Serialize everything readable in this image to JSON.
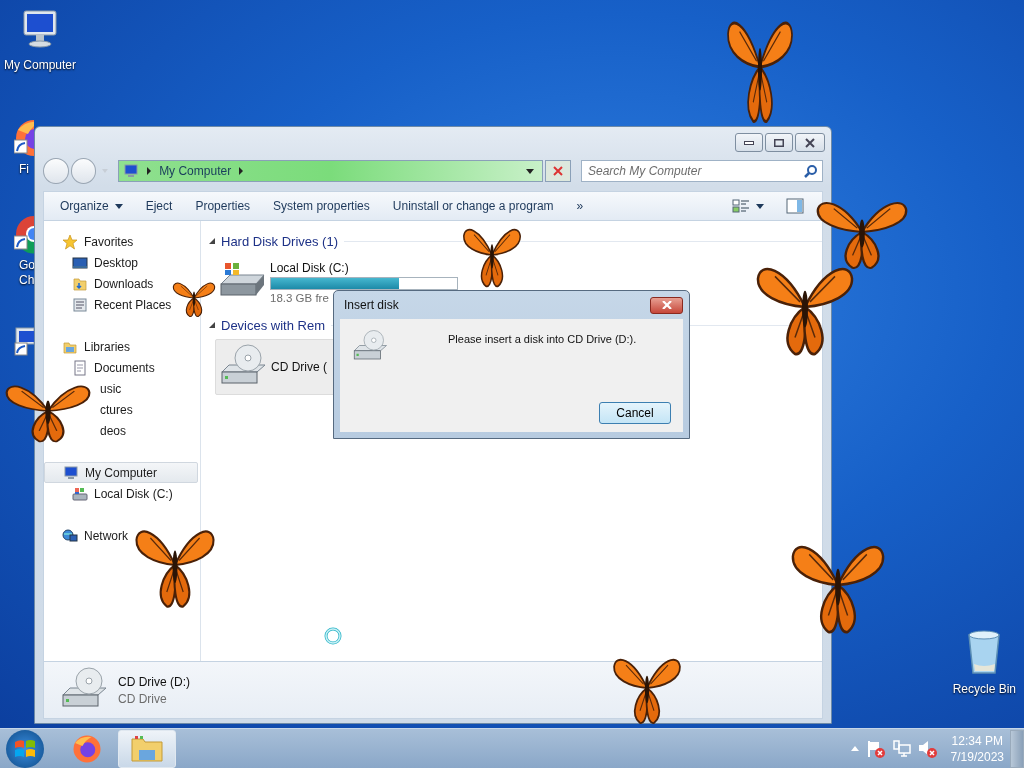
{
  "desktop_icons": [
    {
      "kind": "computer",
      "label": "My Computer"
    },
    {
      "kind": "firefox",
      "label": "Fi"
    },
    {
      "kind": "chrome",
      "label": "Go Ch"
    },
    {
      "kind": "computer-shortcut"
    }
  ],
  "recycle_bin": {
    "label": "Recycle Bin"
  },
  "explorer": {
    "address": {
      "path": [
        "My Computer"
      ]
    },
    "search": {
      "placeholder": "Search My Computer"
    },
    "toolbar": [
      {
        "label": "Organize",
        "dropdown": true
      },
      {
        "label": "Eject",
        "dropdown": false
      },
      {
        "label": "Properties",
        "dropdown": false
      },
      {
        "label": "System properties",
        "dropdown": false
      },
      {
        "label": "Uninstall or change a program",
        "dropdown": false
      }
    ],
    "toolbar_more": "»",
    "sidebar": [
      {
        "label": "Favorites",
        "kind": "favorites",
        "selected": false,
        "children": [
          {
            "label": "Desktop",
            "kind": "desktop"
          },
          {
            "label": "Downloads",
            "kind": "downloads"
          },
          {
            "label": "Recent Places",
            "kind": "recent"
          }
        ]
      },
      {
        "label": "Libraries",
        "kind": "libraries",
        "selected": false,
        "children": [
          {
            "label": "Documents",
            "kind": "documents"
          },
          {
            "label": "usic",
            "kind": "covered"
          },
          {
            "label": "ctures",
            "kind": "covered"
          },
          {
            "label": "deos",
            "kind": "covered"
          }
        ]
      },
      {
        "label": "My Computer",
        "kind": "computer",
        "selected": true,
        "children": [
          {
            "label": "Local Disk (C:)",
            "kind": "drive"
          }
        ]
      },
      {
        "label": "Network",
        "kind": "network",
        "selected": false
      }
    ],
    "sections": [
      {
        "title": "Hard Disk Drives (1)",
        "expanded": true,
        "items": [
          {
            "kind": "hdd",
            "name": "Local Disk (C:)",
            "level": 0.69,
            "free": "18.3 GB fre",
            "selected": false
          }
        ]
      },
      {
        "title": "Devices with Rem",
        "expanded": true,
        "items": [
          {
            "kind": "cd",
            "name": "CD Drive (",
            "selected": true
          }
        ]
      }
    ],
    "details": {
      "kind": "cd",
      "name": "CD Drive (D:)",
      "type": "CD Drive"
    }
  },
  "dialog": {
    "title": "Insert disk",
    "message": "Please insert a disk into CD Drive (D:).",
    "buttons": [
      "Cancel"
    ]
  },
  "taskbar": {
    "apps": [
      {
        "kind": "firefox",
        "selected": false
      },
      {
        "kind": "explorer",
        "selected": true
      }
    ],
    "time": "12:34 PM",
    "date": "7/19/2023"
  }
}
